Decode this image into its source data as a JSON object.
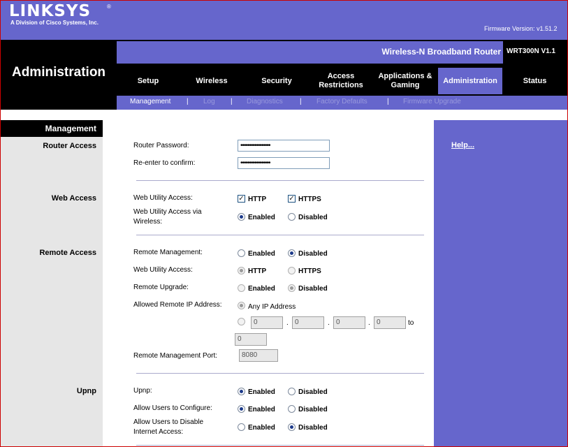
{
  "brand": {
    "logo": "LINKSYS",
    "tagline": "A Division of Cisco Systems, Inc."
  },
  "firmware_version": "Firmware Version: v1.51.2",
  "router_name": "Wireless-N Broadband Router",
  "model": "WRT300N V1.1",
  "page_title": "Administration",
  "tabs": [
    {
      "label": "Setup"
    },
    {
      "label": "Wireless"
    },
    {
      "label": "Security"
    },
    {
      "label": "Access Restrictions"
    },
    {
      "label": "Applications & Gaming"
    },
    {
      "label": "Administration"
    },
    {
      "label": "Status"
    }
  ],
  "subtabs": [
    {
      "label": "Management"
    },
    {
      "label": "Log"
    },
    {
      "label": "Diagnostics"
    },
    {
      "label": "Factory Defaults"
    },
    {
      "label": "Firmware Upgrade"
    }
  ],
  "sidebar": {
    "heading": "Management",
    "sections": [
      "Router Access",
      "Web Access",
      "Remote Access",
      "Upnp"
    ]
  },
  "help_link": "Help...",
  "router_access": {
    "password_label": "Router Password:",
    "password_value": "•••••••••••••••••",
    "confirm_label": "Re-enter to  confirm:",
    "confirm_value": "•••••••••••••••••"
  },
  "web_access": {
    "utility_label": "Web Utility Access:",
    "http": "HTTP",
    "https": "HTTPS",
    "wireless_label_1": "Web Utility Access via",
    "wireless_label_2": "Wireless:",
    "enabled": "Enabled",
    "disabled": "Disabled"
  },
  "remote_access": {
    "mgmt_label": "Remote  Management:",
    "utility_label": "Web Utility Access:",
    "upgrade_label": "Remote Upgrade:",
    "allowed_ip_label": "Allowed Remote IP Address:",
    "any_ip": "Any IP Address",
    "ip_octets": [
      "0",
      "0",
      "0",
      "0"
    ],
    "ip_dot": ".",
    "to": "to",
    "ip_end": "0",
    "port_label": "Remote Management Port:",
    "port_value": "8080",
    "enabled": "Enabled",
    "disabled": "Disabled",
    "http": "HTTP",
    "https": "HTTPS"
  },
  "upnp": {
    "upnp_label": "Upnp:",
    "configure_label": "Allow Users to Configure:",
    "disable_label_1": "Allow Users to Disable",
    "disable_label_2": "Internet Access:",
    "enabled": "Enabled",
    "disabled": "Disabled"
  },
  "colors": {
    "accent": "#6666cc",
    "black": "#000000",
    "sidebar": "#e6e6e6"
  }
}
